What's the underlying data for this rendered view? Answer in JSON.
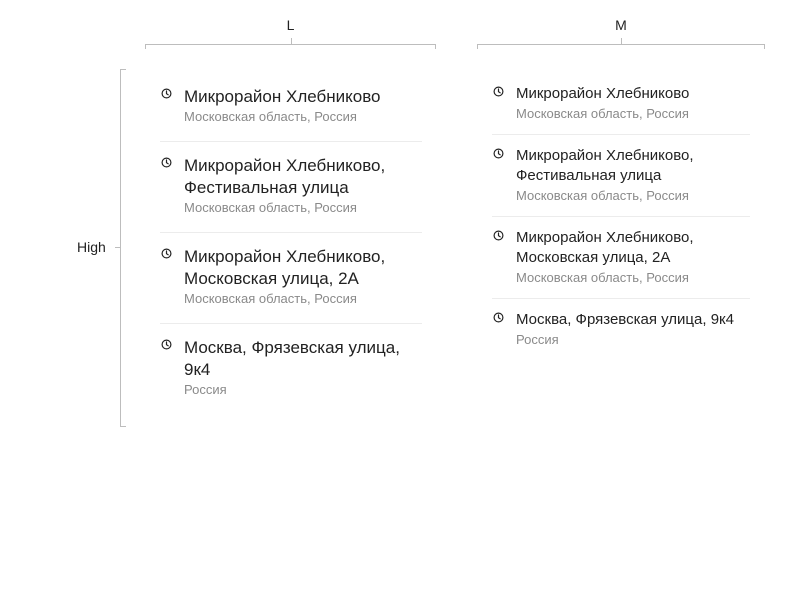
{
  "columns": {
    "l": "L",
    "m": "M"
  },
  "rows": {
    "high": "High"
  },
  "icon": "clock-icon",
  "suggestions_l": [
    {
      "title": "Микрорайон Хлебниково",
      "subtitle": "Московская область, Россия"
    },
    {
      "title": "Микрорайон Хлебниково, Фестивальная улица",
      "subtitle": "Московская область, Россия"
    },
    {
      "title": "Микрорайон Хлебниково, Московская улица, 2А",
      "subtitle": "Московская область, Россия"
    },
    {
      "title": "Москва, Фрязевская улица, 9к4",
      "subtitle": "Россия"
    }
  ],
  "suggestions_m": [
    {
      "title": "Микрорайон Хлебниково",
      "subtitle": "Московская область, Россия"
    },
    {
      "title": "Микрорайон Хлебниково, Фестивальная улица",
      "subtitle": "Московская область, Россия"
    },
    {
      "title": "Микрорайон Хлебниково, Московская улица, 2А",
      "subtitle": "Московская область, Россия"
    },
    {
      "title": "Москва, Фрязевская улица, 9к4",
      "subtitle": "Россия"
    }
  ],
  "colors": {
    "text": "#222222",
    "subtext": "#8a8a8a",
    "divider": "#ececec",
    "bracket": "#bdbdbd"
  }
}
